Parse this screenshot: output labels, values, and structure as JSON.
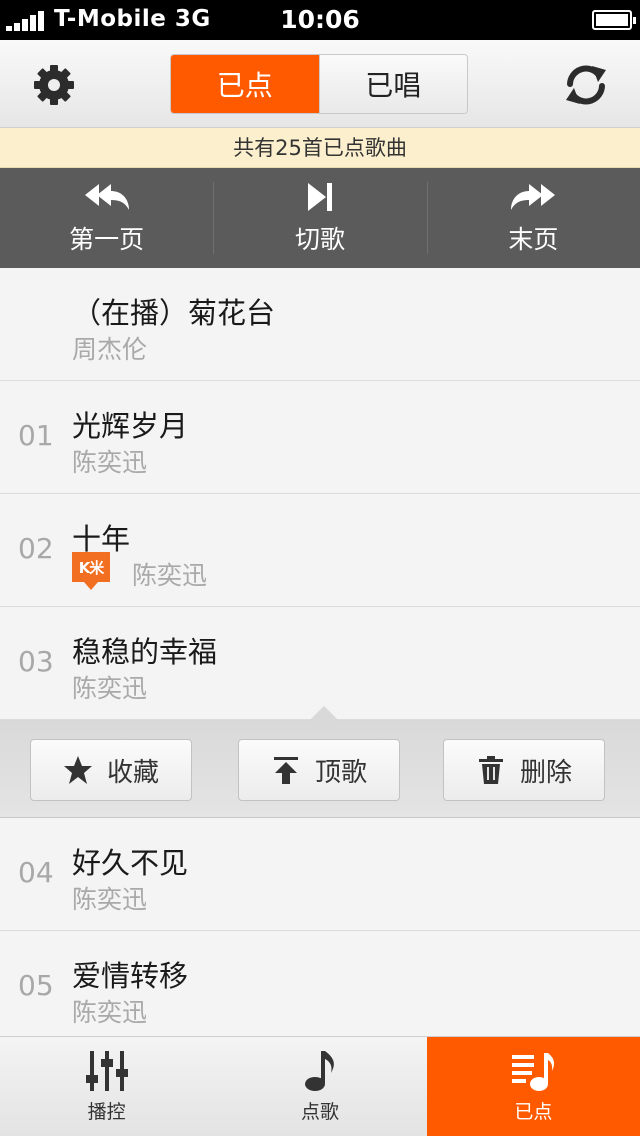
{
  "status_bar": {
    "carrier": "T-Mobile",
    "network": "3G",
    "time": "10:06"
  },
  "top_nav": {
    "tabs": [
      {
        "label": "已点",
        "active": true
      },
      {
        "label": "已唱",
        "active": false
      }
    ]
  },
  "banner": {
    "text": "共有25首已点歌曲"
  },
  "controls": {
    "first_page": "第一页",
    "skip": "切歌",
    "last_page": "末页"
  },
  "songs": [
    {
      "num": "",
      "title": "（在播）菊花台",
      "artist": "周杰伦"
    },
    {
      "num": "01",
      "title": "光辉岁月",
      "artist": "陈奕迅"
    },
    {
      "num": "02",
      "title": "十年",
      "artist": "陈奕迅",
      "badge": "K米"
    },
    {
      "num": "03",
      "title": "稳稳的幸福",
      "artist": "陈奕迅"
    },
    {
      "num": "04",
      "title": "好久不见",
      "artist": "陈奕迅"
    },
    {
      "num": "05",
      "title": "爱情转移",
      "artist": "陈奕迅"
    }
  ],
  "actions": {
    "favorite": "收藏",
    "top": "顶歌",
    "delete": "删除"
  },
  "tab_bar": {
    "tabs": [
      {
        "label": "播控"
      },
      {
        "label": "点歌"
      },
      {
        "label": "已点",
        "active": true
      }
    ]
  },
  "colors": {
    "accent": "#ff5a00",
    "banner_bg": "#fcefcd",
    "control_bar": "#5b5b5b",
    "badge": "#f26e21"
  },
  "icons": {
    "settings": "gear-icon",
    "refresh": "refresh-icon",
    "first": "double-left-arrow-icon",
    "skip": "skip-next-icon",
    "last": "double-right-arrow-icon",
    "favorite": "star-icon",
    "top": "move-top-icon",
    "delete": "trash-icon",
    "playback": "mixer-sliders-icon",
    "request": "music-note-icon",
    "queue": "playlist-icon"
  }
}
